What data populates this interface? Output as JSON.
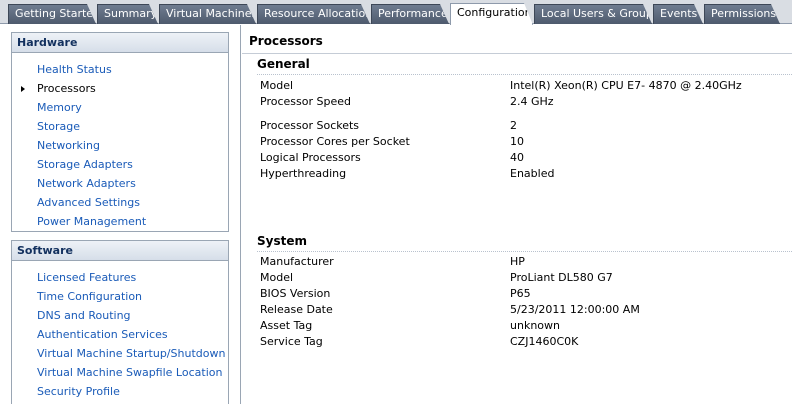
{
  "tabs": [
    {
      "label": "Getting Started"
    },
    {
      "label": "Summary"
    },
    {
      "label": "Virtual Machines"
    },
    {
      "label": "Resource Allocation"
    },
    {
      "label": "Performance"
    },
    {
      "label": "Configuration",
      "active": true
    },
    {
      "label": "Local Users & Groups"
    },
    {
      "label": "Events"
    },
    {
      "label": "Permissions"
    }
  ],
  "hardware": {
    "header": "Hardware",
    "items": [
      {
        "label": "Health Status"
      },
      {
        "label": "Processors",
        "selected": true
      },
      {
        "label": "Memory"
      },
      {
        "label": "Storage"
      },
      {
        "label": "Networking"
      },
      {
        "label": "Storage Adapters"
      },
      {
        "label": "Network Adapters"
      },
      {
        "label": "Advanced Settings"
      },
      {
        "label": "Power Management"
      }
    ]
  },
  "software": {
    "header": "Software",
    "items": [
      {
        "label": "Licensed Features"
      },
      {
        "label": "Time Configuration"
      },
      {
        "label": "DNS and Routing"
      },
      {
        "label": "Authentication Services"
      },
      {
        "label": "Virtual Machine Startup/Shutdown"
      },
      {
        "label": "Virtual Machine Swapfile Location"
      },
      {
        "label": "Security Profile"
      }
    ]
  },
  "main": {
    "title": "Processors",
    "general": {
      "title": "General",
      "rows": [
        {
          "label": "Model",
          "value": "Intel(R) Xeon(R) CPU E7- 4870  @ 2.40GHz"
        },
        {
          "label": "Processor Speed",
          "value": "2.4 GHz"
        },
        {
          "label": "Processor Sockets",
          "value": "2"
        },
        {
          "label": "Processor Cores per Socket",
          "value": "10"
        },
        {
          "label": "Logical Processors",
          "value": "40"
        },
        {
          "label": "Hyperthreading",
          "value": "Enabled"
        }
      ]
    },
    "system": {
      "title": "System",
      "rows": [
        {
          "label": "Manufacturer",
          "value": "HP"
        },
        {
          "label": "Model",
          "value": "ProLiant DL580 G7"
        },
        {
          "label": "BIOS Version",
          "value": "P65"
        },
        {
          "label": "Release Date",
          "value": "5/23/2011 12:00:00 AM"
        },
        {
          "label": "Asset Tag",
          "value": "unknown"
        },
        {
          "label": "Service Tag",
          "value": "CZJ1460C0K"
        }
      ]
    }
  }
}
